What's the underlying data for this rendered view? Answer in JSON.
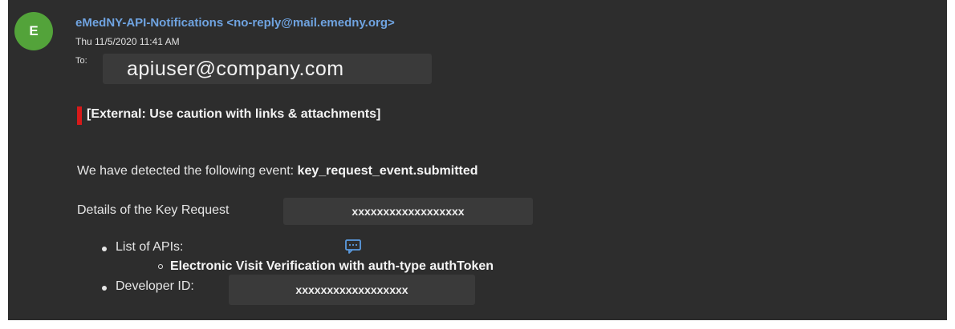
{
  "message": {
    "avatar_initial": "E",
    "avatar_color": "#53a33a",
    "sender": "eMedNY-API-Notifications <no-reply@mail.emedny.org>",
    "sent": "Thu 11/5/2020 11:41 AM",
    "to_label": "To:",
    "to_value": "apiuser@company.com"
  },
  "banner": {
    "text": "[External: Use caution with links & attachments]",
    "accent_color": "#d71a1a"
  },
  "body": {
    "event_prefix": "We have detected the following event: ",
    "event_name": "key_request_event.submitted",
    "details_label": "Details of the Key Request",
    "details_value": "xxxxxxxxxxxxxxxxxx",
    "list_apis_label": "List of APIs:",
    "api_item": "Electronic Visit Verification with auth-type authToken",
    "developer_id_label": "Developer ID:",
    "developer_id_value": "xxxxxxxxxxxxxxxxxx"
  },
  "icons": {
    "comment": "comment-icon"
  }
}
